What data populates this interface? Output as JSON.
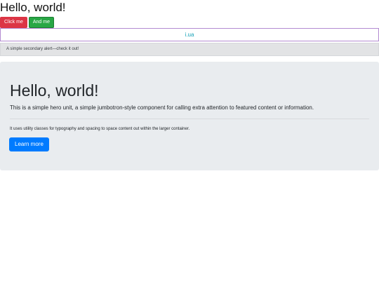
{
  "header": {
    "title": "Hello, world!"
  },
  "buttons": {
    "click_me": "Click me",
    "and_me": "And me"
  },
  "link_bar": {
    "text": "i.ua"
  },
  "alert": {
    "text": "A simple secondary alert—check it out!"
  },
  "jumbotron": {
    "title": "Hello, world!",
    "lead": "This is a simple hero unit, a simple jumbotron-style component for calling extra attention to featured content or information.",
    "body": "It uses utility classes for typography and spacing to space content out within the larger container.",
    "button_label": "Learn more"
  },
  "colors": {
    "danger": "#dc3545",
    "success": "#28a745",
    "info_link": "#17a2b8",
    "primary": "#007bff",
    "jumbotron_bg": "#e9ecef",
    "alert_bg": "#e2e3e5"
  }
}
